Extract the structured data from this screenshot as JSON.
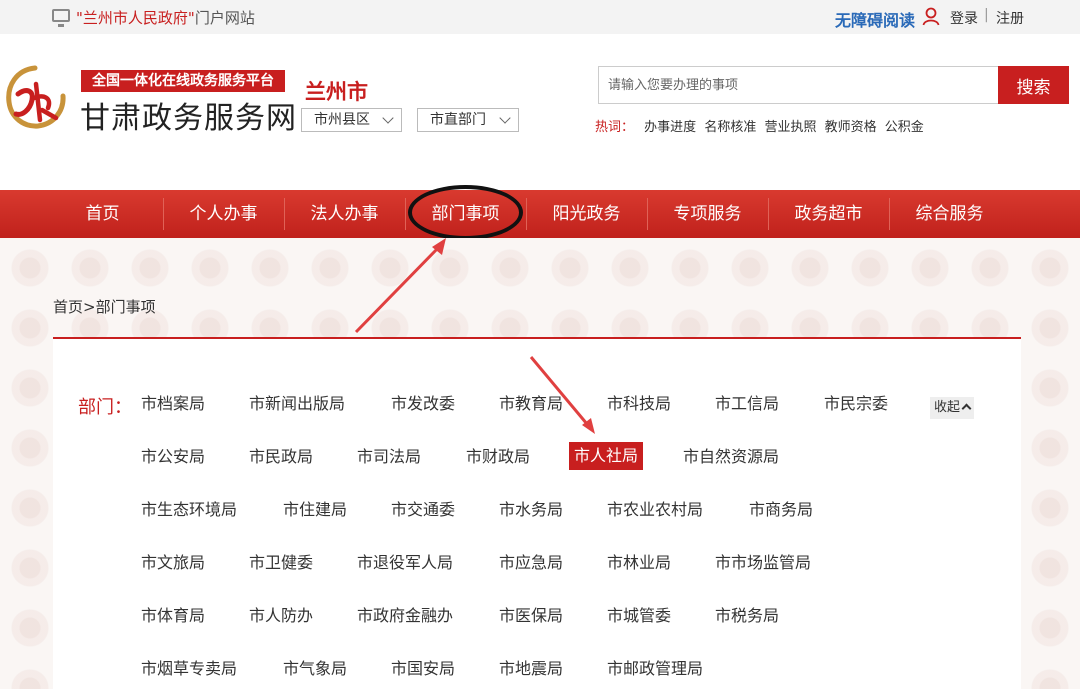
{
  "topbar": {
    "portal_name": "\"兰州市人民政府\"",
    "portal_suffix": "门户网站",
    "accessibility": "无障碍阅读",
    "login": "登录",
    "divider": "|",
    "register": "注册"
  },
  "header": {
    "slogan": "全国一体化在线政务服务平台",
    "site_name": "甘肃政务服务网",
    "city": "兰州市",
    "county_select": "市州县区",
    "dept_select": "市直部门",
    "search_placeholder": "请输入您要办理的事项",
    "search_button": "搜索",
    "hot_label": "热词：",
    "hot_keywords": [
      "办事进度",
      "名称核准",
      "营业执照",
      "教师资格",
      "公积金"
    ]
  },
  "nav": {
    "items": [
      "首页",
      "个人办事",
      "法人办事",
      "部门事项",
      "阳光政务",
      "专项服务",
      "政务超市",
      "综合服务"
    ],
    "circled_index": 3
  },
  "breadcrumb": "首页>部门事项",
  "departments": {
    "label": "部门：",
    "collapse": "收起",
    "active": "市人社局",
    "rows": [
      [
        "市档案局",
        "市新闻出版局",
        "市发改委",
        "市教育局",
        "市科技局",
        "市工信局",
        "市民宗委"
      ],
      [
        "市公安局",
        "市民政局",
        "市司法局",
        "市财政局",
        "市人社局",
        "市自然资源局"
      ],
      [
        "市生态环境局",
        "市住建局",
        "市交通委",
        "市水务局",
        "市农业农村局",
        "市商务局"
      ],
      [
        "市文旅局",
        "市卫健委",
        "市退役军人局",
        "市应急局",
        "市林业局",
        "市市场监管局"
      ],
      [
        "市体育局",
        "市人防办",
        "市政府金融办",
        "市医保局",
        "市城管委",
        "市税务局"
      ],
      [
        "市烟草专卖局",
        "市气象局",
        "市国安局",
        "市地震局",
        "市邮政管理局"
      ]
    ]
  },
  "colors": {
    "brand_red": "#c81f1f",
    "accessibility_blue": "#2a6ab8"
  }
}
